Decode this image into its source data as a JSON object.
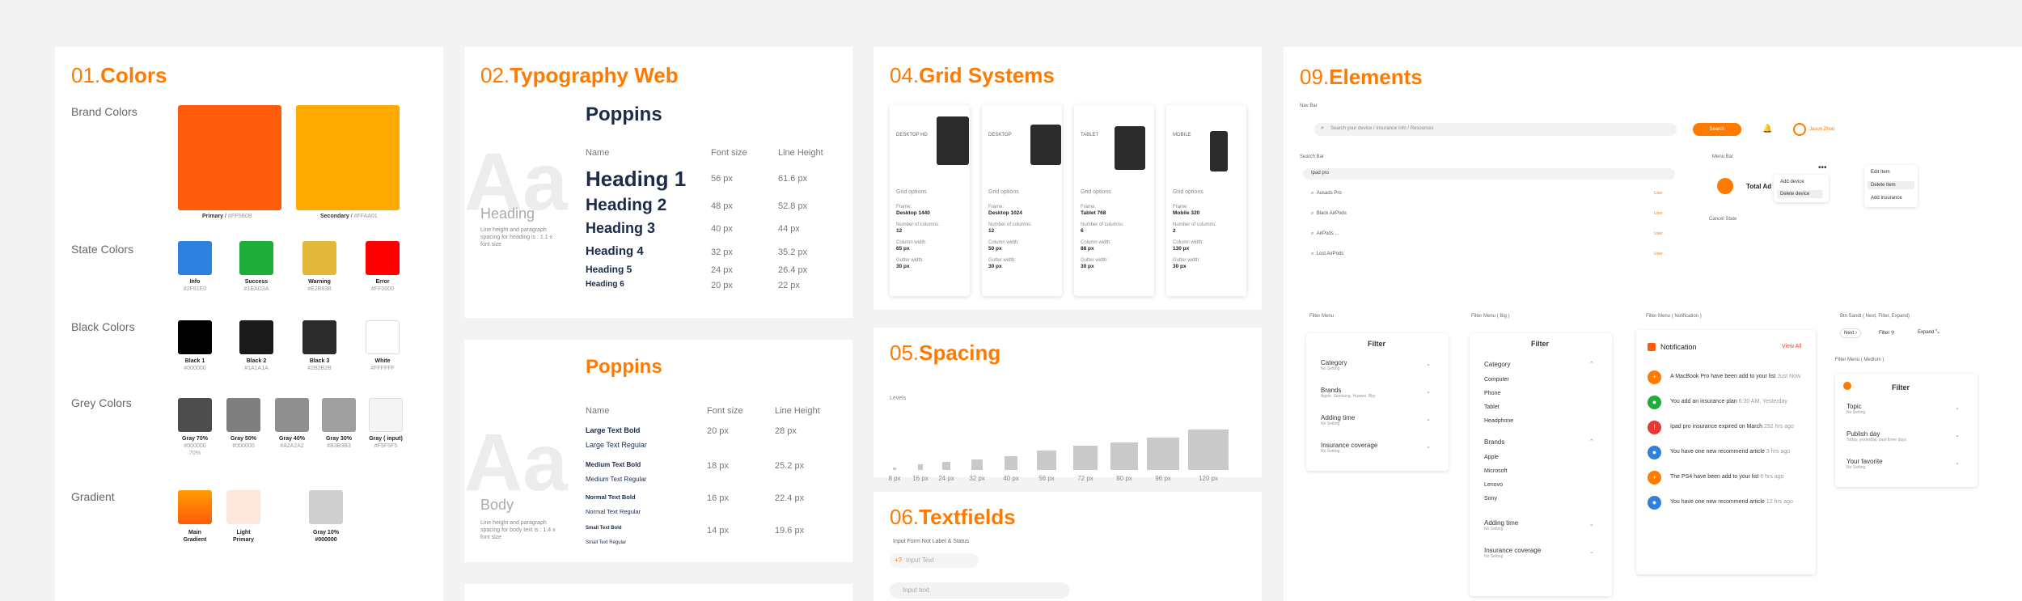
{
  "colors": {
    "num": "01.",
    "title": "Colors",
    "brand_label": "Brand Colors",
    "state_label": "State Colors",
    "black_label": "Black Colors",
    "grey_label": "Grey Colors",
    "gradient_label": "Gradient",
    "brand": [
      {
        "name": "Primary",
        "hex": "#FF5B0B",
        "color": "#ff5b0b"
      },
      {
        "name": "Secondary",
        "hex": "#FFAA01",
        "color": "#ffaa01"
      }
    ],
    "state": [
      {
        "name": "Info",
        "hex": "#2F81E0",
        "color": "#2f81e0"
      },
      {
        "name": "Success",
        "hex": "#1EAD3A",
        "color": "#1ead3a"
      },
      {
        "name": "Warning",
        "hex": "#E2B83B",
        "color": "#e2b83b"
      },
      {
        "name": "Error",
        "hex": "#FF0000",
        "color": "#ff0000"
      }
    ],
    "black": [
      {
        "name": "Black 1",
        "hex": "#000000",
        "color": "#000000"
      },
      {
        "name": "Black 2",
        "hex": "#1A1A1A",
        "color": "#1a1a1a"
      },
      {
        "name": "Black 3",
        "hex": "#2B2B2B",
        "color": "#2b2b2b"
      },
      {
        "name": "White",
        "hex": "#FFFFFF",
        "color": "#ffffff"
      }
    ],
    "grey": [
      {
        "name": "Gray 70%",
        "hex": "#000000",
        "extra": "70%",
        "color": "#4d4d4d"
      },
      {
        "name": "Gray 50%",
        "hex": "#000000",
        "color": "#7f7f7f"
      },
      {
        "name": "Gray 40%",
        "hex": "#A2A2A2",
        "color": "#8f8f8f"
      },
      {
        "name": "Gray 30%",
        "hex": "#B3B3B3",
        "color": "#a0a0a0"
      },
      {
        "name": "Gray ( input)",
        "hex": "#F5F5F5",
        "color": "#f5f5f5"
      }
    ],
    "gradient": [
      {
        "name": "Main",
        "name2": "Gradient"
      },
      {
        "name": "Light",
        "name2": "Primary"
      },
      {
        "name": "Gray 10%",
        "name2": "#000000"
      }
    ]
  },
  "typo": {
    "num": "02.",
    "title": "Typography Web",
    "font": "Poppins",
    "aa": "Aa",
    "heading_cap": "Heading",
    "heading_desc": "Line height and paragraph spacing for heading is : 1.1 x font size",
    "body_cap": "Body",
    "body_desc": "Line height and paragraph spacing for body text is : 1.4 x font size",
    "col_name": "Name",
    "col_size": "Font size",
    "col_lh": "Line Height",
    "headings": [
      {
        "name": "Heading 1",
        "size": "56 px",
        "lh": "61.6 px"
      },
      {
        "name": "Heading 2",
        "size": "48 px",
        "lh": "52.8 px"
      },
      {
        "name": "Heading 3",
        "size": "40 px",
        "lh": "44 px"
      },
      {
        "name": "Heading 4",
        "size": "32 px",
        "lh": "35.2 px"
      },
      {
        "name": "Heading 5",
        "size": "24 px",
        "lh": "26.4 px"
      },
      {
        "name": "Heading 6",
        "size": "20 px",
        "lh": "22 px"
      }
    ],
    "body": [
      {
        "bold": "Large Text Bold",
        "reg": "Large Text Regular",
        "size": "20 px",
        "lh": "28 px"
      },
      {
        "bold": "Medium Text Bold",
        "reg": "Medium Text Regular",
        "size": "18 px",
        "lh": "25.2 px"
      },
      {
        "bold": "Normal Text Bold",
        "reg": "Normal Text Regular",
        "size": "16 px",
        "lh": "22.4 px"
      },
      {
        "bold": "Small Text Bold",
        "reg": "Small Text Regular",
        "size": "14 px",
        "lh": "19.6 px"
      }
    ]
  },
  "grid": {
    "num": "04.",
    "title": "Grid Systems",
    "go": "Grid options",
    "frame": "Frame:",
    "cols": "Number of columns:",
    "cw": "Column width:",
    "gw": "Gutter width:",
    "cards": [
      {
        "label": "DESKTOP HD",
        "frame": "Desktop 1440",
        "cols": "12",
        "cw": "65 px",
        "gw": "30 px"
      },
      {
        "label": "DESKTOP",
        "frame": "Desktop 1024",
        "cols": "12",
        "cw": "50 px",
        "gw": "30 px"
      },
      {
        "label": "TABLET",
        "frame": "Tablet 768",
        "cols": "6",
        "cw": "88 px",
        "gw": "30 px"
      },
      {
        "label": "MOBILE",
        "frame": "Mobile 320",
        "cols": "2",
        "cw": "130 px",
        "gw": "30 px"
      }
    ]
  },
  "spacing": {
    "num": "05.",
    "title": "Spacing",
    "levels": "Levels",
    "items": [
      {
        "label": "8 px",
        "v": 8
      },
      {
        "label": "16 px",
        "v": 16
      },
      {
        "label": "24 px",
        "v": 24
      },
      {
        "label": "32 px",
        "v": 32
      },
      {
        "label": "40 px",
        "v": 40
      },
      {
        "label": "56 px",
        "v": 56
      },
      {
        "label": "72 px",
        "v": 72
      },
      {
        "label": "80 px",
        "v": 80
      },
      {
        "label": "96 px",
        "v": 96
      },
      {
        "label": "120 px",
        "v": 120
      }
    ]
  },
  "text": {
    "num": "06.",
    "title": "Textfields",
    "sub": "Input Form Not Label & Status",
    "ph1": "Input Text",
    "ph2": "Input text"
  },
  "elements": {
    "num": "09.",
    "title": "Elements",
    "navbar": "Nav Bar",
    "nav_search": "Search your device / insurance info / Resources",
    "nav_btn": "Search",
    "user": "Jason Zhou",
    "searchbar": "Search Bar",
    "search_val": "Ipad pro",
    "results": [
      {
        "t": "Ausads Pro",
        "tag": "User"
      },
      {
        "t": "Black AirPods",
        "tag": "User"
      },
      {
        "t": "AirPods ...",
        "tag": "User"
      },
      {
        "t": "Lost AirPods",
        "tag": "User"
      }
    ],
    "menubar": "Menu Bar",
    "total": "Total Ad",
    "add_device": "Add device",
    "delete_device": "Delete device",
    "cancel": "Cancel State",
    "edit_item": "Edit Item",
    "delete_item": "Delete Item",
    "add_insurance": "Add Insurance",
    "filter_menu": "Filter Menu",
    "filter_big": "Filter Menu ( Big )",
    "filter_notif": "Filter Menu ( Notification )",
    "btn_sandt": "Btn Sandt ( Next, Filter, Expand)",
    "filter_medium": "Filter Menu ( Medium )",
    "filter": "Filter",
    "no_setting": "No Setting",
    "f1": [
      "Category",
      "Brands",
      "Adding time",
      "Insurance coverage"
    ],
    "brand_sub": "Apple, Samsung, Huawei, Bby",
    "cats": [
      "Computer",
      "Phone",
      "Tablet",
      "Headphone"
    ],
    "brands": [
      "Apple",
      "Microsoft",
      "Lenovo",
      "Sony"
    ],
    "notif": "Notification",
    "view_all": "View All",
    "notifs": [
      {
        "t": "A MacBook Pro have been add to your list",
        "time": "Just Now",
        "c": "#ff7a00",
        "i": "+"
      },
      {
        "t": "You add an insurance plan",
        "time": "6:30 AM, Yesterday",
        "c": "#1ead3a",
        "i": "●"
      },
      {
        "t": "Ipad pro insurance expired on March",
        "time": "292 hrs ago",
        "c": "#e53935",
        "i": "!"
      },
      {
        "t": "You have one new recommend article",
        "time": "3 hrs ago",
        "c": "#2f81e0",
        "i": "●"
      },
      {
        "t": "The PS4 have been add to your list",
        "time": "6 hrs ago",
        "c": "#ff7a00",
        "i": "+"
      },
      {
        "t": "You have one new recommend article",
        "time": "12 hrs ago",
        "c": "#2f81e0",
        "i": "●"
      }
    ],
    "next": "Next",
    "filter_btn": "Filter",
    "expand": "Expand",
    "medium": [
      {
        "t": "Topic",
        "s": "No Setting"
      },
      {
        "t": "Publish day",
        "s": "Today, yesterday, past three days"
      },
      {
        "t": "Your favorite",
        "s": "No Setting"
      }
    ]
  }
}
